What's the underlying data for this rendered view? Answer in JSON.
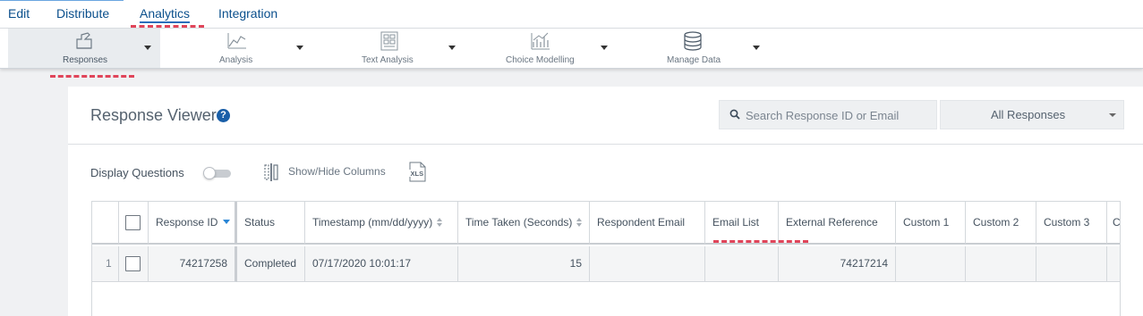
{
  "nav": {
    "items": [
      "Edit",
      "Distribute",
      "Analytics",
      "Integration"
    ],
    "active": "Analytics"
  },
  "toolbar": {
    "tools": [
      {
        "label": "Responses",
        "icon": "responses-icon",
        "selected": true
      },
      {
        "label": "Analysis",
        "icon": "analysis-chart-icon"
      },
      {
        "label": "Text Analysis",
        "icon": "text-analysis-icon"
      },
      {
        "label": "Choice Modelling",
        "icon": "choice-modelling-icon"
      },
      {
        "label": "Manage Data",
        "icon": "database-icon"
      }
    ]
  },
  "viewer": {
    "title": "Response Viewer",
    "help": "?",
    "search_placeholder": "Search Response ID or Email",
    "filter_value": "All Responses",
    "display_questions_label": "Display Questions",
    "display_questions_on": false,
    "show_hide_columns_label": "Show/Hide Columns",
    "export_icon": "xls-file-icon"
  },
  "table": {
    "columns": [
      "Response ID",
      "Status",
      "Timestamp (mm/dd/yyyy)",
      "Time Taken (Seconds)",
      "Respondent Email",
      "Email List",
      "External Reference",
      "Custom 1",
      "Custom 2",
      "Custom 3",
      "Cu"
    ],
    "rows": [
      {
        "index": "1",
        "response_id": "74217258",
        "status": "Completed",
        "timestamp": "07/17/2020 10:01:17",
        "time_taken": "15",
        "respondent_email": "",
        "email_list": "",
        "external_reference": "74217214",
        "custom1": "",
        "custom2": "",
        "custom3": ""
      }
    ]
  },
  "colors": {
    "accent": "#0a4f8c",
    "highlight_dash": "#e0455a",
    "help_icon": "#1a5fa8"
  }
}
